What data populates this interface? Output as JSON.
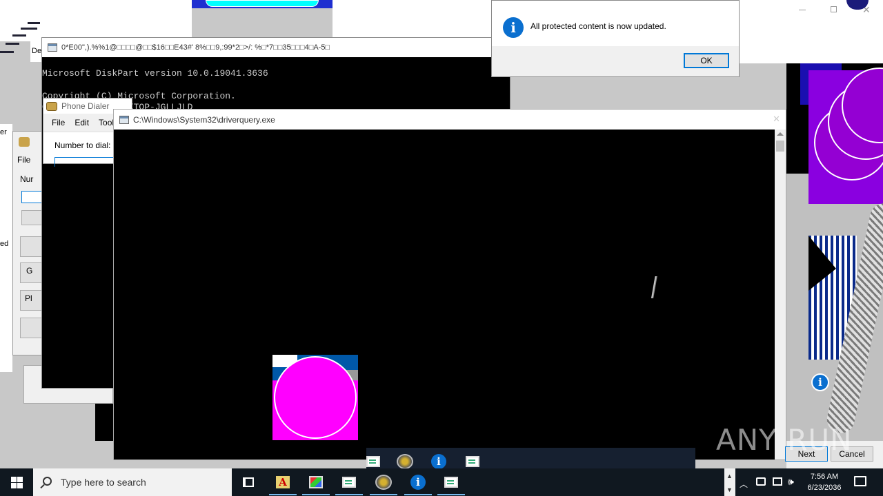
{
  "dialog": {
    "message": "All protected content is now updated.",
    "ok_label": "OK",
    "info_glyph": "i"
  },
  "cmd_window": {
    "title": "0*E00\",).%%1@□□□□@□□$16□□E43#' 8%□□9,:99*2□>/: %□*7□□35□□□4□A-5□",
    "line1": "Microsoft DiskPart version 10.0.19041.3636",
    "line2": "Copyright (C) Microsoft Corporation.",
    "line3": "On computer: DESKTOP-JGLLJLD"
  },
  "phone_dialer": {
    "title": "Phone Dialer",
    "menu": [
      "File",
      "Edit",
      "Tools"
    ],
    "number_label": "Number to dial:"
  },
  "phone_dialer_back": {
    "menu_file": "File",
    "number_label": "Nur",
    "btn_g": "G",
    "btn_ph": "Pl",
    "side_text_1": "er",
    "side_text_2": "ed",
    "tab_de": "De"
  },
  "driverquery": {
    "title": "C:\\Windows\\System32\\driverquery.exe"
  },
  "wizard": {
    "next_label": "Next",
    "cancel_label": "Cancel"
  },
  "watermark": "ANY RUN",
  "taskbar": {
    "search_placeholder": "Type here to search",
    "clock_time": "7:56 AM",
    "clock_date": "6/23/2036"
  },
  "icons": {
    "start": "windows-start-icon",
    "search": "search-icon",
    "task_view": "task-view-icon",
    "info": "info-icon"
  },
  "colors": {
    "taskbar": "#101820",
    "info_blue": "#0a6fcf",
    "magenta": "#ff00ff",
    "purple": "#9400d3",
    "cyan": "#00ffff"
  }
}
